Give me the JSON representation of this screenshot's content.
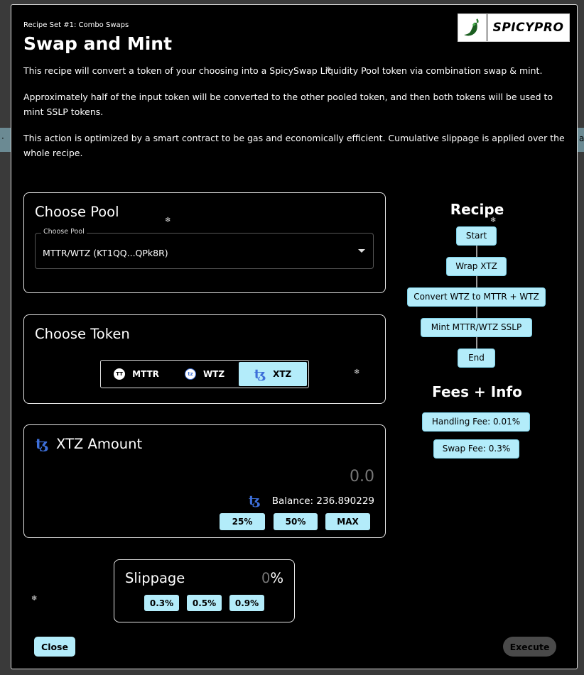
{
  "background": {
    "left_tab_glyph": "·",
    "right_tab_glyph": "a"
  },
  "header": {
    "subtitle": "Recipe Set #1: Combo Swaps",
    "title": "Swap and Mint",
    "logo_text": "SPICYPRO"
  },
  "description": [
    "This recipe will convert a token of your choosing into a SpicySwap Liquidity Pool token via combination swap & mint.",
    "Approximately half of the input token will be converted to the other pooled token, and then both tokens will be used to mint SSLP tokens.",
    "This action is optimized by a smart contract to be gas and economically efficient. Cumulative slippage is applied over the whole recipe."
  ],
  "choose_pool": {
    "title": "Choose Pool",
    "legend": "Choose Pool",
    "value": "MTTR/WTZ (KT1QQ...QPk8R)"
  },
  "choose_token": {
    "title": "Choose Token",
    "options": [
      {
        "label": "MTTR",
        "icon_text": "TT",
        "icon": "mttr-token-icon"
      },
      {
        "label": "WTZ",
        "icon_text": "tz",
        "icon": "wtz-token-icon"
      },
      {
        "label": "XTZ",
        "icon_text": "ꜩ",
        "icon": "tezos-icon"
      }
    ],
    "selected": "XTZ"
  },
  "amount": {
    "title": "XTZ Amount",
    "icon_text": "ꜩ",
    "value": "0.0",
    "balance": "Balance: 236.890229",
    "buttons": [
      "25%",
      "50%",
      "MAX"
    ]
  },
  "slippage": {
    "title": "Slippage",
    "value": "0",
    "unit": "%",
    "options": [
      "0.3%",
      "0.5%",
      "0.9%"
    ]
  },
  "recipe": {
    "title": "Recipe",
    "steps": [
      "Start",
      "Wrap XTZ",
      "Convert WTZ to MTTR + WTZ",
      "Mint MTTR/WTZ SSLP",
      "End"
    ]
  },
  "fees": {
    "title": "Fees + Info",
    "items": [
      "Handling Fee: 0.01%",
      "Swap Fee: 0.3%"
    ]
  },
  "footer": {
    "close_label": "Close",
    "execute_label": "Execute"
  },
  "colors": {
    "accent": "#b3ecfa",
    "tezos_blue": "#3d6fd9",
    "disabled": "#4a4a4a"
  }
}
